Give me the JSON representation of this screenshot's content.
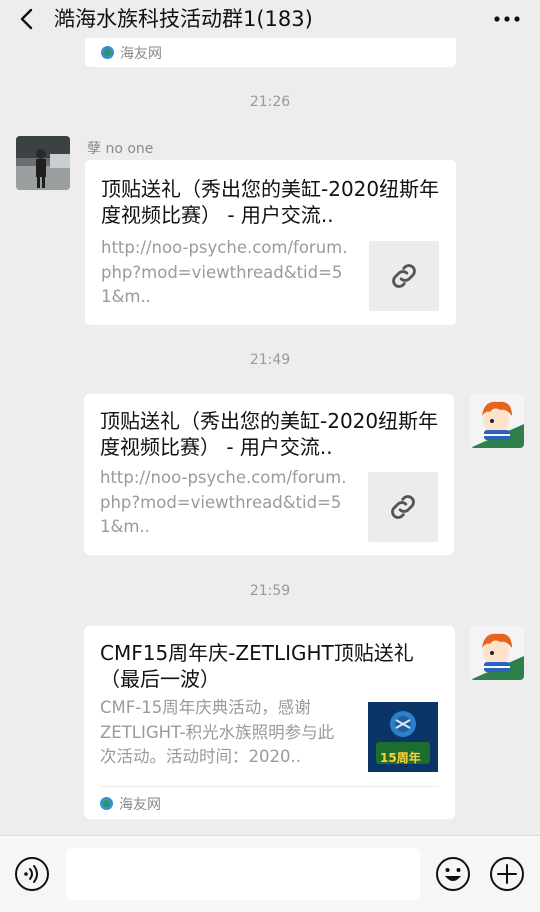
{
  "header": {
    "title": "澔海水族科技活动群1(183)"
  },
  "messages": {
    "top_card": {
      "source": "海友网"
    },
    "time1": "21:26",
    "msg1": {
      "sender": "孽 no one",
      "title": "顶贴送礼（秀出您的美缸-2020纽斯年度视频比赛） - 用户交流..",
      "desc": "http://noo-psyche.com/forum.php?mod=viewthread&tid=51&m.."
    },
    "time2": "21:49",
    "msg2": {
      "title": "顶贴送礼（秀出您的美缸-2020纽斯年度视频比赛） - 用户交流..",
      "desc": "http://noo-psyche.com/forum.php?mod=viewthread&tid=51&m.."
    },
    "time3": "21:59",
    "msg3": {
      "title": "CMF15周年庆-ZETLIGHT顶贴送礼（最后一波）",
      "desc": "CMF-15周年庆典活动，感谢ZETLIGHT-积光水族照明参与此次活动。活动时间：2020..",
      "thumb_label": "15周年",
      "source": "海友网"
    }
  },
  "input": {
    "value": "",
    "placeholder": ""
  },
  "colors": {
    "background": "#ededed",
    "bubble": "#ffffff",
    "muted": "#9a9a9a"
  }
}
